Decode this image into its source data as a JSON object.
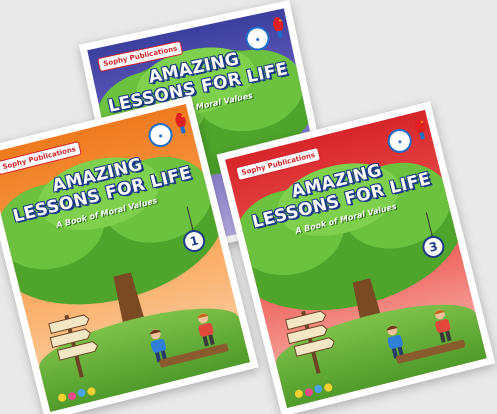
{
  "books": [
    {
      "id": "back",
      "publisher": "Sophy Publications",
      "title_line1": "AMAZING",
      "title_line2": "LESSONS FOR LIFE",
      "subtitle": "A Book of Moral Values",
      "volume": "",
      "theme": "purple"
    },
    {
      "id": "left",
      "publisher": "Sophy Publications",
      "title_line1": "AMAZING",
      "title_line2": "LESSONS FOR LIFE",
      "subtitle": "A Book of Moral Values",
      "volume": "1",
      "theme": "orange"
    },
    {
      "id": "right",
      "publisher": "Sophy Publications",
      "title_line1": "AMAZING",
      "title_line2": "LESSONS FOR LIFE",
      "subtitle": "A Book of Moral Values",
      "volume": "3",
      "theme": "red"
    }
  ],
  "colors": {
    "background": "#e9e9e9",
    "title_outline": "#1d3b86",
    "purple_cover": "#4a47b0",
    "orange_cover": "#f28a2e",
    "red_cover": "#e03a36",
    "tree_green": "#5bb232",
    "trunk_brown": "#7a4a22"
  }
}
